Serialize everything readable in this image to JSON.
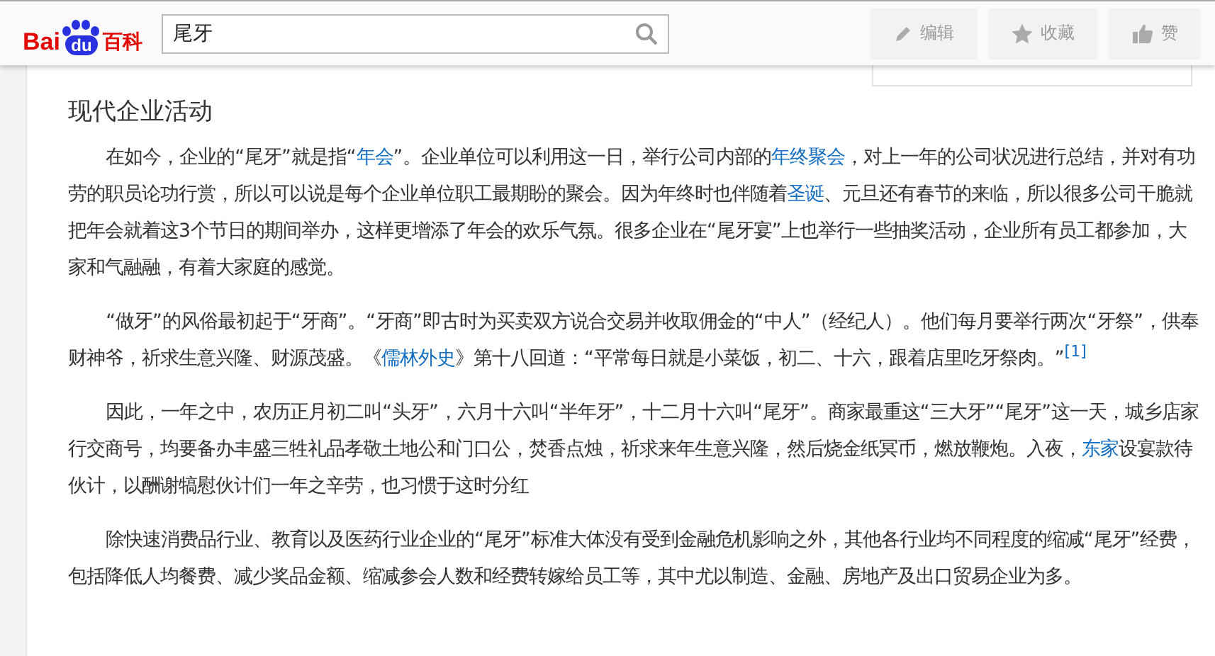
{
  "header": {
    "logo": {
      "left": "Bai",
      "paw": "du",
      "right": "百科"
    },
    "search": {
      "value": "尾牙"
    },
    "actions": [
      {
        "kind": "edit",
        "label": "编辑"
      },
      {
        "kind": "favorite",
        "label": "收藏"
      },
      {
        "kind": "like",
        "label": "赞"
      }
    ]
  },
  "section": {
    "title": "现代企业活动",
    "paragraphs": [
      [
        {
          "kind": "text",
          "text": "在如今，企业的“尾牙”就是指“"
        },
        {
          "kind": "link",
          "text": "年会"
        },
        {
          "kind": "text",
          "text": "”。企业单位可以利用这一日，举行公司内部的"
        },
        {
          "kind": "link",
          "text": "年终聚会"
        },
        {
          "kind": "text",
          "text": "，对上一年的公司状况进行总结，并对有功劳的职员论功行赏，所以可以说是每个企业单位职工最期盼的聚会。因为年终时也伴随着"
        },
        {
          "kind": "link",
          "text": "圣诞"
        },
        {
          "kind": "text",
          "text": "、元旦还有春节的来临，所以很多公司干脆就把年会就着这3个节日的期间举办，这样更增添了年会的欢乐气氛。很多企业在“尾牙宴”上也举行一些抽奖活动，企业所有员工都参加，大家和气融融，有着大家庭的感觉。"
        }
      ],
      [
        {
          "kind": "text",
          "text": "“做牙”的风俗最初起于“牙商”。“牙商”即古时为买卖双方说合交易并收取佣金的“中人”（经纪人）。他们每月要举行两次“牙祭”，供奉财神爷，祈求生意兴隆、财源茂盛。《"
        },
        {
          "kind": "link",
          "text": "儒林外史"
        },
        {
          "kind": "text",
          "text": "》第十八回道：“平常每日就是小菜饭，初二、十六，跟着店里吃牙祭肉。”"
        },
        {
          "kind": "footnote",
          "text": "[1]"
        }
      ],
      [
        {
          "kind": "text",
          "text": "因此，一年之中，农历正月初二叫“头牙”，六月十六叫“半年牙”，十二月十六叫“尾牙”。商家最重这“三大牙”“尾牙”这一天，城乡店家行交商号，均要备办丰盛三牲礼品孝敬土地公和门口公，焚香点烛，祈求来年生意兴隆，然后烧金纸冥币，燃放鞭炮。入夜，"
        },
        {
          "kind": "link",
          "text": "东家"
        },
        {
          "kind": "text",
          "text": "设宴款待伙计，以酬谢犒慰伙计们一年之辛劳，也习惯于这时分红"
        }
      ],
      [
        {
          "kind": "text",
          "text": "除快速消费品行业、教育以及医药行业企业的“尾牙”标准大体没有受到金融危机影响之外，其他各行业均不同程度的缩减“尾牙”经费，包括降低人均餐费、减少奖品金额、缩减参会人数和经费转嫁给员工等，其中尤以制造、金融、房地产及出口贸易企业为多。"
        }
      ]
    ]
  }
}
